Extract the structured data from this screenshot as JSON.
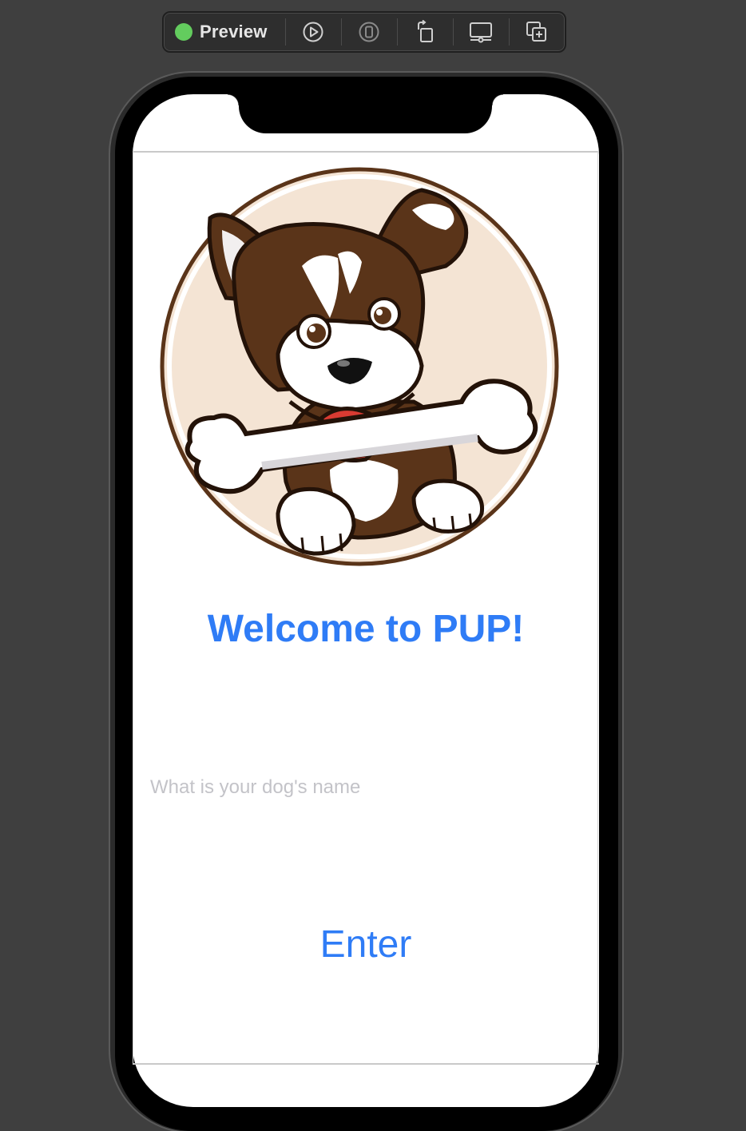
{
  "toolbar": {
    "preview_label": "Preview",
    "status_color": "#63cc5e",
    "buttons": [
      {
        "icon": "live-preview-play-icon"
      },
      {
        "icon": "device-preview-icon"
      },
      {
        "icon": "rotate-device-icon"
      },
      {
        "icon": "device-settings-icon"
      },
      {
        "icon": "duplicate-preview-icon"
      }
    ]
  },
  "app": {
    "logo_icon": "pup-dog-with-bone-logo",
    "title": "Welcome to PUP!",
    "name_field": {
      "placeholder": "What is your dog's name",
      "value": ""
    },
    "enter_label": "Enter",
    "accent_color": "#2f7cf6"
  }
}
